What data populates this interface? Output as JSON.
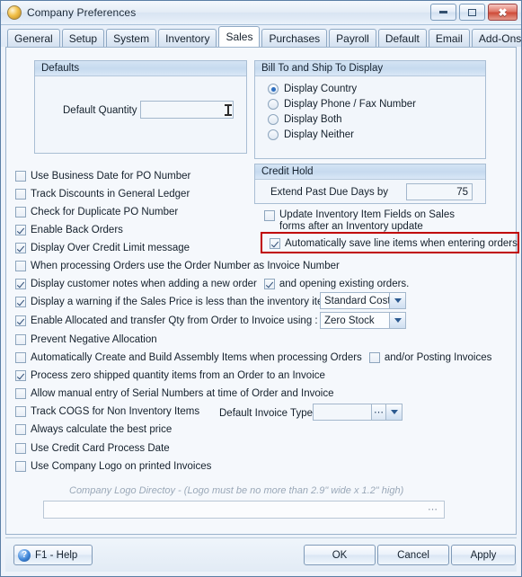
{
  "window": {
    "title": "Company Preferences",
    "icon": "app-icon",
    "buttons": {
      "minimize": "minimize-icon",
      "maximize": "maximize-icon",
      "close": "✖"
    }
  },
  "tabs": [
    {
      "label": "General",
      "active": false
    },
    {
      "label": "Setup",
      "active": false
    },
    {
      "label": "System",
      "active": false
    },
    {
      "label": "Inventory",
      "active": false
    },
    {
      "label": "Sales",
      "active": true
    },
    {
      "label": "Purchases",
      "active": false
    },
    {
      "label": "Payroll",
      "active": false
    },
    {
      "label": "Default",
      "active": false
    },
    {
      "label": "Email",
      "active": false
    },
    {
      "label": "Add-Ons",
      "active": false
    }
  ],
  "defaults_group": {
    "title": "Defaults",
    "quantity_label": "Default Quantity",
    "quantity_value": "",
    "quantity_placeholder": ""
  },
  "bill_ship_group": {
    "title": "Bill To and Ship To Display",
    "options": [
      {
        "label": "Display Country",
        "selected": true
      },
      {
        "label": "Display Phone / Fax Number",
        "selected": false
      },
      {
        "label": "Display Both",
        "selected": false
      },
      {
        "label": "Display Neither",
        "selected": false
      }
    ]
  },
  "credit_hold_group": {
    "title": "Credit Hold",
    "extend_label": "Extend Past Due Days by",
    "extend_value": "75"
  },
  "right_checkboxes": [
    {
      "label_line1": "Update Inventory Item Fields on Sales",
      "label_line2": "forms after an Inventory update",
      "checked": false
    },
    {
      "label_line1": "Automatically save line items when entering orders",
      "label_line2": "",
      "checked": true,
      "highlighted": true
    }
  ],
  "left_checkboxes": [
    {
      "label": "Use Business Date for PO Number",
      "checked": false
    },
    {
      "label": "Track Discounts in General Ledger",
      "checked": false
    },
    {
      "label": "Check for Duplicate PO Number",
      "checked": false
    },
    {
      "label": "Enable Back Orders",
      "checked": true
    },
    {
      "label": "Display Over Credit Limit message",
      "checked": true
    },
    {
      "label": "When processing Orders use the Order Number as Invoice Number",
      "checked": false
    },
    {
      "label": "Display customer notes when adding a new order",
      "checked": true
    },
    {
      "label": "Display a warning if the Sales Price is less than the inventory items",
      "checked": true
    },
    {
      "label": "Enable Allocated and transfer Qty from Order to Invoice using :",
      "checked": true
    },
    {
      "label": "Prevent Negative Allocation",
      "checked": false
    },
    {
      "label": "Automatically Create and Build Assembly Items when processing Orders",
      "checked": false
    },
    {
      "label": "Process zero shipped quantity items from an Order to an Invoice",
      "checked": true
    },
    {
      "label": "Allow manual entry of Serial Numbers at time of Order and Invoice",
      "checked": false
    },
    {
      "label": "Track COGS for Non Inventory Items",
      "checked": false
    },
    {
      "label": "Always calculate the best price",
      "checked": false
    },
    {
      "label": "Use Credit Card Process Date",
      "checked": false
    },
    {
      "label": "Use Company Logo on printed Invoices",
      "checked": false
    }
  ],
  "inline_checkboxes": {
    "opening_existing_orders": {
      "label": "and opening existing orders.",
      "checked": true
    },
    "posting_invoices": {
      "label": "and/or Posting Invoices",
      "checked": false
    }
  },
  "selects": {
    "cost_method": {
      "value": "Standard Cost"
    },
    "stock_method": {
      "value": "Zero Stock"
    }
  },
  "default_invoice_type": {
    "label": "Default Invoice Type",
    "value": "",
    "browse_label": "…"
  },
  "company_logo": {
    "caption": "Company Logo Directoy - (Logo must be no more than 2.9\" wide x 1.2\" high)",
    "value": "",
    "browse_label": "…"
  },
  "footer": {
    "help_label": "F1 - Help",
    "help_glyph": "?",
    "ok_label": "OK",
    "cancel_label": "Cancel",
    "apply_label": "Apply"
  },
  "colors": {
    "highlight": "#c00000",
    "accent": "#2f6fc0",
    "window_border": "#5b7fa6"
  }
}
